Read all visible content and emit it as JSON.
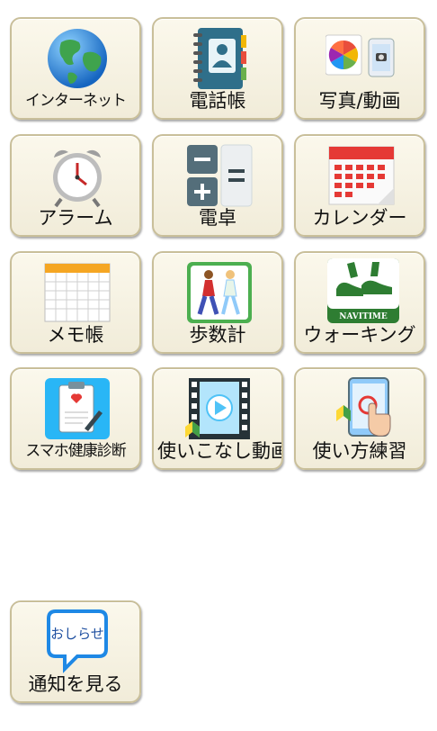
{
  "apps": {
    "internet": {
      "label": "インターネット",
      "icon": "globe-icon"
    },
    "phonebook": {
      "label": "電話帳",
      "icon": "contacts-book-icon"
    },
    "photos": {
      "label": "写真/動画",
      "icon": "photos-icon"
    },
    "alarm": {
      "label": "アラーム",
      "icon": "alarm-clock-icon"
    },
    "calculator": {
      "label": "電卓",
      "icon": "calculator-icon"
    },
    "calendar": {
      "label": "カレンダー",
      "icon": "calendar-icon"
    },
    "memo": {
      "label": "メモ帳",
      "icon": "notepad-icon"
    },
    "pedometer": {
      "label": "歩数計",
      "icon": "walking-people-icon"
    },
    "walking": {
      "label": "ウォーキング",
      "icon": "navitime-shoe-icon",
      "badge": "NAVITIME"
    },
    "health": {
      "label": "スマホ健康診断",
      "icon": "clipboard-heart-icon"
    },
    "tutorial_video": {
      "label": "使いこなし動画",
      "icon": "video-film-icon"
    },
    "practice": {
      "label": "使い方練習",
      "icon": "tap-tablet-icon"
    },
    "notifications": {
      "label": "通知を見る",
      "icon": "notice-bubble-icon",
      "badge": "おしらせ"
    }
  }
}
